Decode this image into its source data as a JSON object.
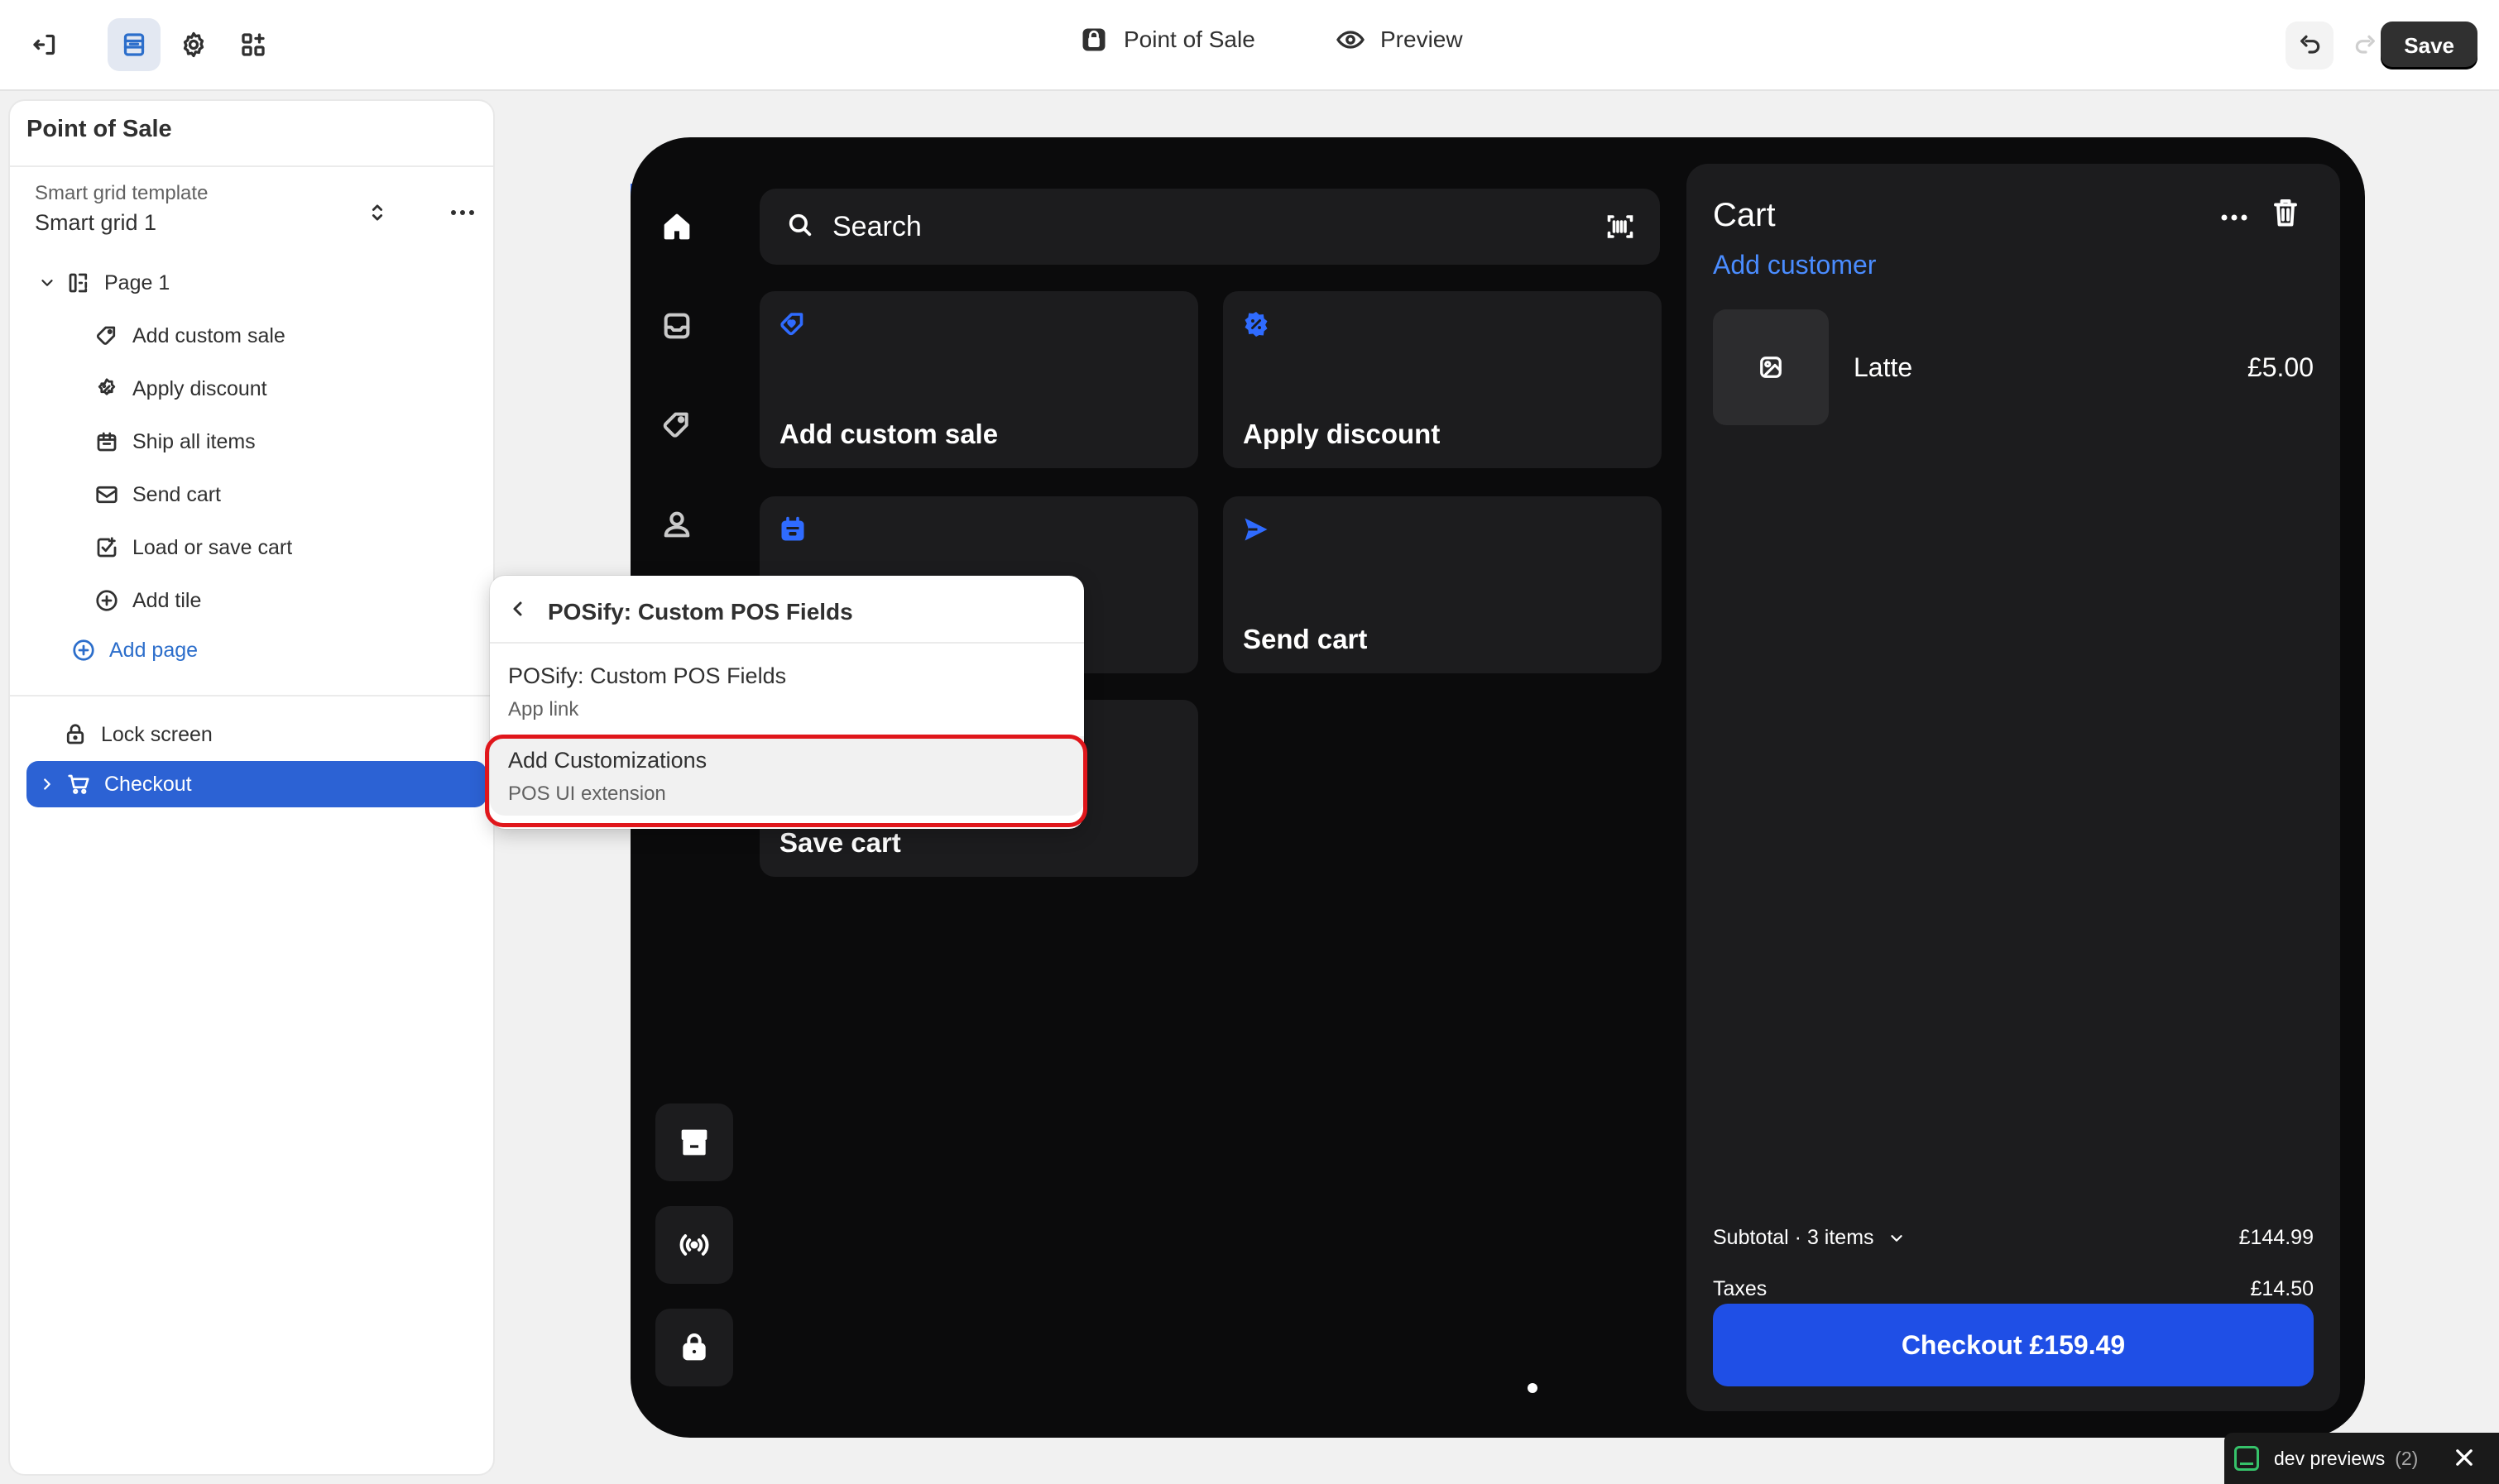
{
  "topbar": {
    "center_title": "Point of Sale",
    "preview_label": "Preview",
    "save_label": "Save"
  },
  "sidebar": {
    "title": "Point of Sale",
    "template_label": "Smart grid template",
    "template_value": "Smart grid 1",
    "page": {
      "label": "Page 1"
    },
    "tiles": [
      {
        "label": "Add custom sale",
        "icon": "custom-sale-icon"
      },
      {
        "label": "Apply discount",
        "icon": "discount-icon"
      },
      {
        "label": "Ship all items",
        "icon": "ship-icon"
      },
      {
        "label": "Send cart",
        "icon": "send-cart-icon"
      },
      {
        "label": "Load or save cart",
        "icon": "save-cart-icon"
      },
      {
        "label": "Add tile",
        "icon": "plus-circle-icon"
      }
    ],
    "add_page_label": "Add page",
    "lock_screen_label": "Lock screen",
    "checkout_label": "Checkout"
  },
  "pos": {
    "search_placeholder": "Search",
    "tiles": [
      {
        "label": "Add custom sale",
        "icon": "heart-tag-icon"
      },
      {
        "label": "Apply discount",
        "icon": "discount-badge-icon"
      },
      {
        "label": "",
        "icon": "calendar-box-icon"
      },
      {
        "label": "Send cart",
        "icon": "paper-plane-icon"
      },
      {
        "label": "Save cart",
        "icon": ""
      }
    ],
    "cart": {
      "title": "Cart",
      "add_customer": "Add customer",
      "line_item": {
        "name": "Latte",
        "price": "£5.00"
      },
      "subtotal_label": "Subtotal · 3 items",
      "subtotal_value": "£144.99",
      "taxes_label": "Taxes",
      "taxes_value": "£14.50",
      "checkout_label": "Checkout £159.49"
    }
  },
  "popover": {
    "title": "POSify: Custom POS Fields",
    "items": [
      {
        "title": "POSify: Custom POS Fields",
        "subtitle": "App link"
      },
      {
        "title": "Add Customizations",
        "subtitle": "POS UI extension"
      }
    ]
  },
  "dev_previews": {
    "label": "dev previews",
    "count": "(2)"
  },
  "colors": {
    "accent_blue": "#2c62d4",
    "pos_accent": "#2f6bff",
    "pos_checkout": "#1f4fe6",
    "highlight_ring": "#e0161b",
    "device_bg": "#0b0b0c"
  }
}
